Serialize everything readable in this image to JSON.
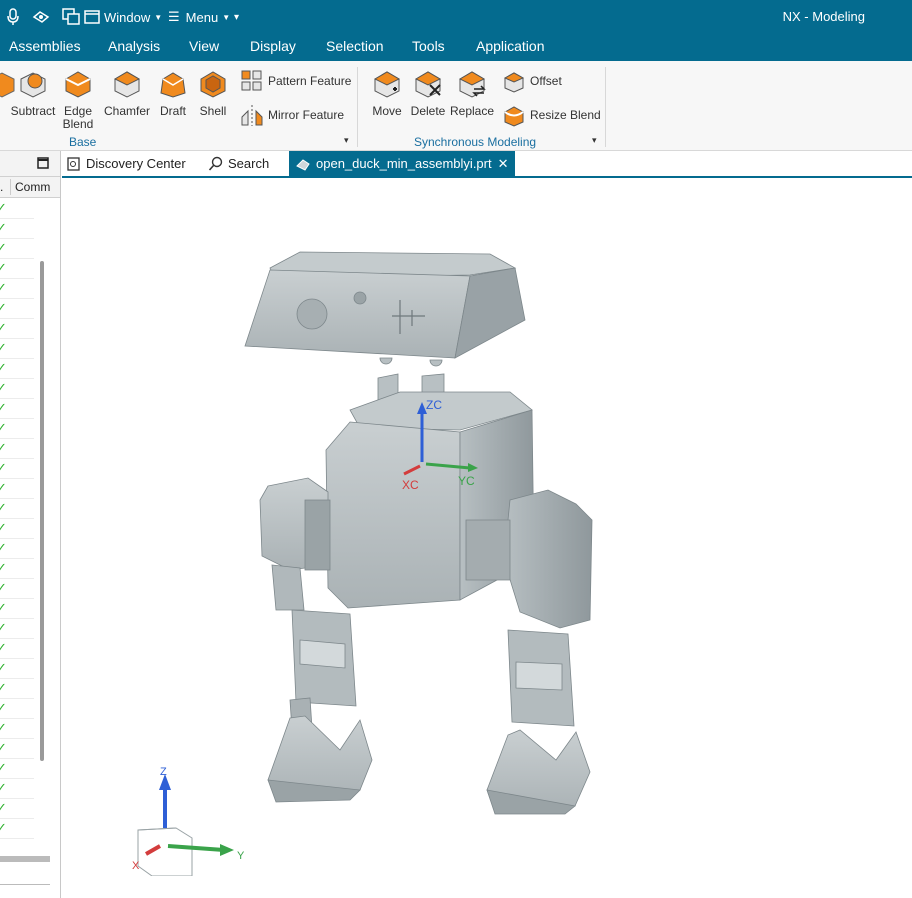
{
  "titlebar": {
    "window_label": "Window",
    "menu_label": "Menu",
    "app_title": "NX - Modeling"
  },
  "menubar": {
    "items": [
      "Assemblies",
      "Analysis",
      "View",
      "Display",
      "Selection",
      "Tools",
      "Application"
    ]
  },
  "ribbon": {
    "base_tools": [
      "Subtract",
      "Edge Blend",
      "Chamfer",
      "Draft",
      "Shell"
    ],
    "pattern_feature": "Pattern Feature",
    "mirror_feature": "Mirror Feature",
    "base_group_label": "Base",
    "sync_tools": [
      "Move",
      "Delete",
      "Replace"
    ],
    "offset": "Offset",
    "resize_blend": "Resize Blend",
    "sync_group_label": "Synchronous Modeling"
  },
  "tabs": {
    "discovery_center": "Discovery Center",
    "search": "Search",
    "active_file": "open_duck_min_assemblyi.prt"
  },
  "nav_panel": {
    "col1": ".",
    "col2": "Comm"
  },
  "viewport": {
    "datum_labels": {
      "zc": "ZC",
      "xc": "XC",
      "yc": "YC"
    },
    "triad_labels": {
      "z": "Z",
      "x": "X",
      "y": "Y"
    },
    "accent": "#046b8f"
  }
}
